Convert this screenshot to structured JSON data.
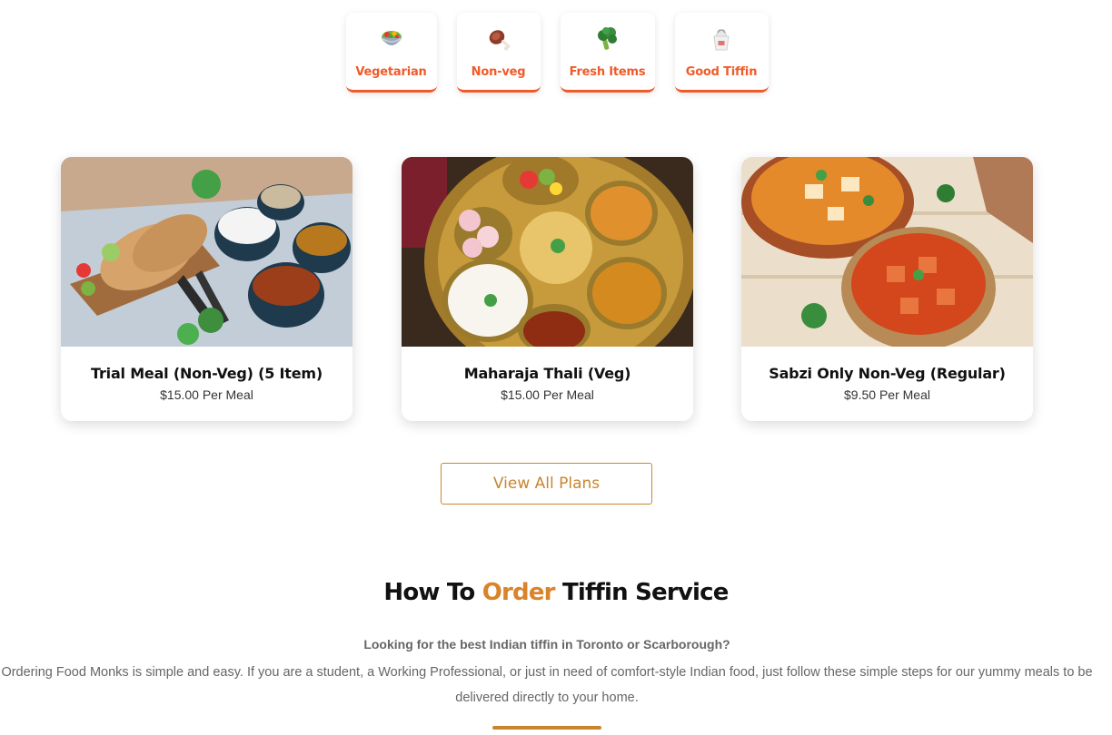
{
  "categories": [
    {
      "label": "Vegetarian",
      "icon": "salad-bowl-icon"
    },
    {
      "label": "Non-veg",
      "icon": "meat-on-bone-icon"
    },
    {
      "label": "Fresh Items",
      "icon": "broccoli-icon"
    },
    {
      "label": "Good Tiffin",
      "icon": "takeout-box-icon"
    }
  ],
  "plans": [
    {
      "title": "Trial Meal (Non-Veg) (5 Item)",
      "price": "$15.00 Per Meal",
      "image": "tiffin-bowls-with-rotis"
    },
    {
      "title": "Maharaja Thali (Veg)",
      "price": "$15.00 Per Meal",
      "image": "brass-thali-platter"
    },
    {
      "title": "Sabzi Only Non-Veg (Regular)",
      "price": "$9.50 Per Meal",
      "image": "paneer-curry-pots"
    }
  ],
  "view_all_label": "View All Plans",
  "how_to": {
    "title_pre": "How To ",
    "title_accent": "Order",
    "title_post": " Tiffin Service",
    "lead": "Looking for the best Indian tiffin in Toronto or Scarborough?",
    "description": "Ordering Food Monks is simple and easy. If you are a student, a Working Professional, or just in need of comfort-style Indian food, just follow these simple steps for our yummy meals to be delivered directly to your home."
  },
  "colors": {
    "accent_orange": "#f05a28",
    "accent_gold": "#c9852e",
    "title_accent": "#d9832a"
  }
}
